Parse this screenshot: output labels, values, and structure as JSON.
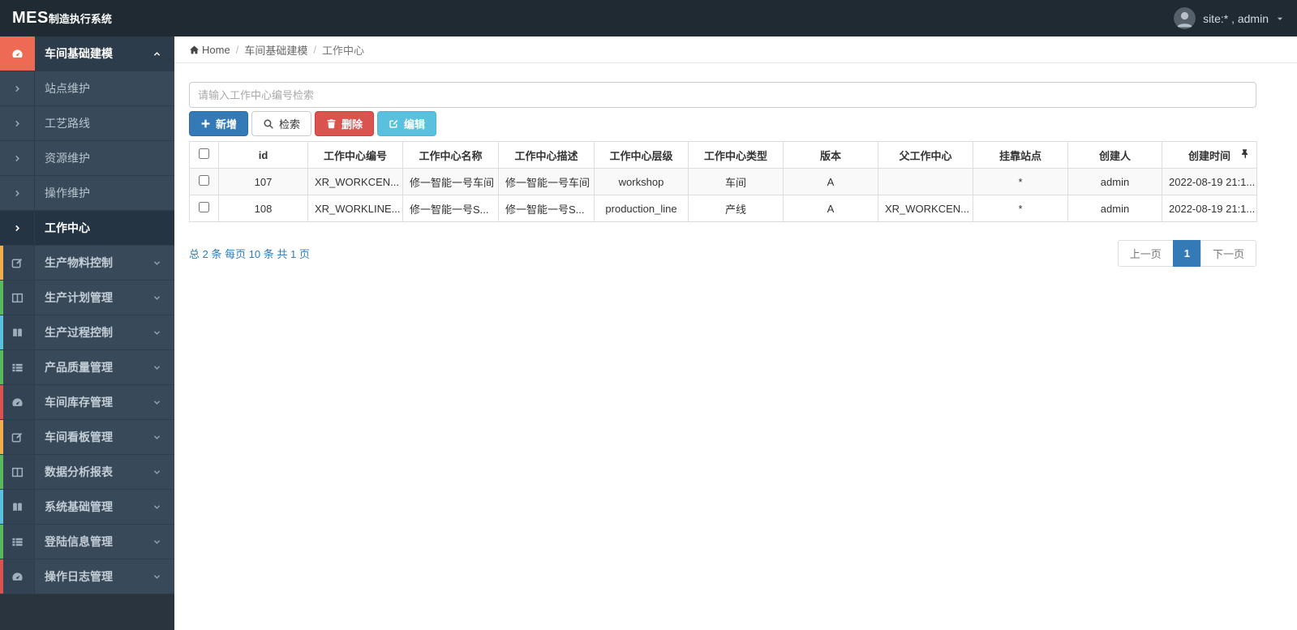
{
  "navbar": {
    "logo_bold": "MES",
    "logo_rest": "制造执行系统",
    "user_label": "site:* , admin"
  },
  "breadcrumb": {
    "home": "Home",
    "section": "车间基础建模",
    "current": "工作中心"
  },
  "sidebar": {
    "items": [
      {
        "label": "车间基础建模",
        "icon": "dashboard-icon",
        "state": "expanded-active"
      },
      {
        "label": "生产物料控制",
        "icon": "edit-icon",
        "strip": "#f0ad4e"
      },
      {
        "label": "生产计划管理",
        "icon": "columns-icon",
        "strip": "#5cb85c"
      },
      {
        "label": "生产过程控制",
        "icon": "book-icon",
        "strip": "#5bc0de"
      },
      {
        "label": "产品质量管理",
        "icon": "list-icon",
        "strip": "#5cb85c"
      },
      {
        "label": "车间库存管理",
        "icon": "dashboard-icon",
        "strip": "#d9534f"
      },
      {
        "label": "车间看板管理",
        "icon": "edit-icon",
        "strip": "#f0ad4e"
      },
      {
        "label": "数据分析报表",
        "icon": "columns-icon",
        "strip": "#5cb85c"
      },
      {
        "label": "系统基础管理",
        "icon": "book-icon",
        "strip": "#5bc0de"
      },
      {
        "label": "登陆信息管理",
        "icon": "list-icon",
        "strip": "#5cb85c"
      },
      {
        "label": "操作日志管理",
        "icon": "dashboard-icon",
        "strip": "#d9534f"
      }
    ],
    "subitems": [
      {
        "label": "站点维护"
      },
      {
        "label": "工艺路线"
      },
      {
        "label": "资源维护"
      },
      {
        "label": "操作维护"
      },
      {
        "label": "工作中心",
        "active": true
      }
    ]
  },
  "toolbar": {
    "search_placeholder": "请输入工作中心编号检索",
    "add_label": "新增",
    "search_label": "检索",
    "delete_label": "删除",
    "edit_label": "编辑"
  },
  "table": {
    "headers": [
      "id",
      "工作中心编号",
      "工作中心名称",
      "工作中心描述",
      "工作中心层级",
      "工作中心类型",
      "版本",
      "父工作中心",
      "挂靠站点",
      "创建人",
      "创建时间"
    ],
    "rows": [
      [
        "107",
        "XR_WORKCEN...",
        "修一智能一号车间",
        "修一智能一号车间",
        "workshop",
        "车间",
        "A",
        "",
        "*",
        "admin",
        "2022-08-19 21:1..."
      ],
      [
        "108",
        "XR_WORKLINE...",
        "修一智能一号S...",
        "修一智能一号S...",
        "production_line",
        "产线",
        "A",
        "XR_WORKCEN...",
        "*",
        "admin",
        "2022-08-19 21:1..."
      ]
    ]
  },
  "pagination": {
    "summary": "总 2 条 每页 10 条 共 1 页",
    "prev": "上一页",
    "page": "1",
    "next": "下一页"
  },
  "colors": {
    "accent_blue": "#337ab7",
    "danger_red": "#d9534f",
    "info_cyan": "#5bc0de",
    "warning_yellow": "#f0ad4e",
    "success_green": "#5cb85c",
    "active_salmon": "#ee6a54",
    "navbar_bg": "#1f2a33",
    "sidebar_row_bg": "#38495a"
  }
}
